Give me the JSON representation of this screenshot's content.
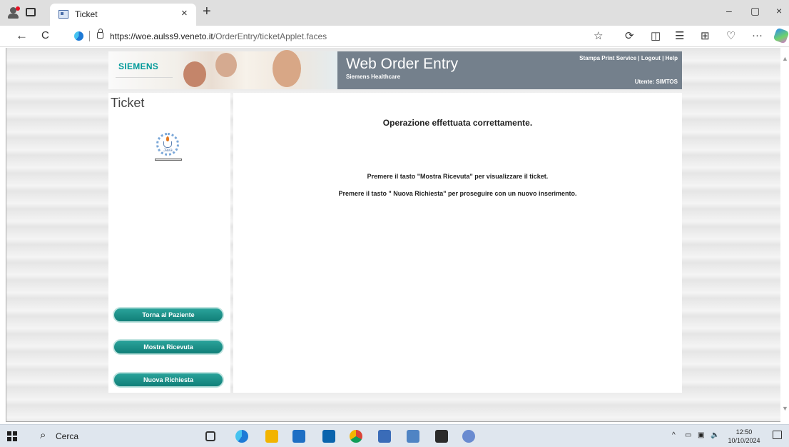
{
  "browser": {
    "tab_title": "Ticket",
    "tab_close": "×",
    "new_tab": "+",
    "url_host": "https://woe.aulss9.veneto.it",
    "url_path": "/OrderEntry/ticketApplet.faces",
    "nav_back": "←",
    "nav_refresh": "C",
    "window_minimize": "–",
    "window_restore": "▢",
    "window_close": "×",
    "more_tools": "···"
  },
  "banner": {
    "brand": "SIEMENS",
    "app_title": "Web Order Entry",
    "app_subtitle": "Siemens Healthcare",
    "link_print_service": "Stampa Print Service",
    "link_separator1": " | ",
    "link_logout": "Logout",
    "link_separator2": " | ",
    "link_help": "Help",
    "user_label": "Utente: SIMTOS"
  },
  "left_panel": {
    "title": "Ticket",
    "java_label": "Java",
    "buttons": {
      "back_to_patient": "Torna al Paziente",
      "show_receipt": "Mostra Ricevuta",
      "new_request": "Nuova Richiesta"
    }
  },
  "main_panel": {
    "success_message": "Operazione effettuata correttamente.",
    "instruction_receipt": "Premere il tasto \"Mostra Ricevuta\" per visualizzare il ticket.",
    "instruction_new": "Premere il tasto \" Nuova Richiesta\" per proseguire con un nuovo inserimento."
  },
  "taskbar": {
    "search_placeholder": "Cerca",
    "time": "12:50",
    "date": "10/10/2024",
    "tray_chevron": "^"
  },
  "colors": {
    "siemens_teal": "#009999",
    "banner_gray": "#74808c",
    "button_teal": "#1a9089"
  }
}
